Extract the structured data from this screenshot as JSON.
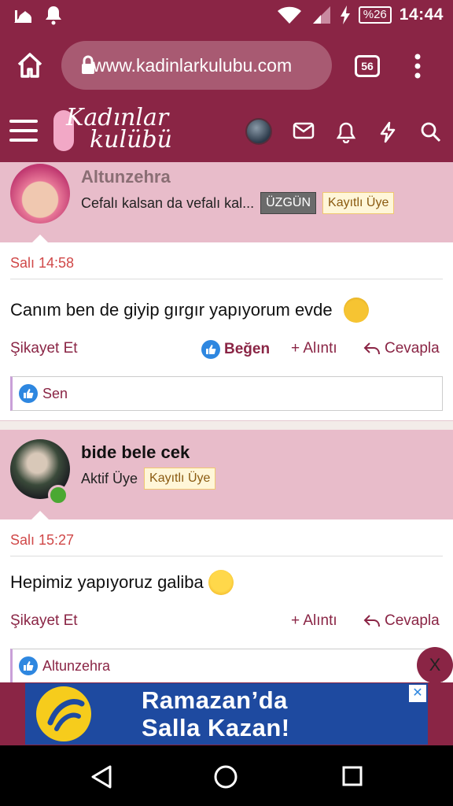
{
  "status_bar": {
    "time": "14:44",
    "battery": "%26"
  },
  "browser": {
    "url": "www.kadinlarkulubu.com",
    "tab_count": "56"
  },
  "site": {
    "logo_line1": "Kadınlar",
    "logo_line2": "kulübü"
  },
  "posts": [
    {
      "username": "Altunzehra",
      "user_title": "Cefalı kalsan da vefalı kal...",
      "badge_mood": "ÜZGÜN",
      "badge_role": "Kayıtlı Üye",
      "date": "Salı 14:58",
      "text": "Canım ben de giyip gırgır yapıyorum evde",
      "report": "Şikayet Et",
      "like": "Beğen",
      "quote": "+ Alıntı",
      "reply": "Cevapla",
      "likes_by": "Sen"
    },
    {
      "username": "bide bele cek",
      "user_title": "Aktif Üye",
      "badge_role": "Kayıtlı Üye",
      "date": "Salı 15:27",
      "text": "Hepimiz yapıyoruz galiba",
      "report": "Şikayet Et",
      "quote": "+ Alıntı",
      "reply": "Cevapla",
      "likes_by": "Altunzehra"
    }
  ],
  "ad": {
    "line1": "Ramazan’da",
    "line2": "Salla Kazan!",
    "close": "X"
  },
  "colors": {
    "brand": "#8a2545",
    "post_header_bg": "#e8bcca",
    "date": "#d04848",
    "like_blue": "#2e87e0",
    "ad_blue": "#1e4aa0"
  }
}
